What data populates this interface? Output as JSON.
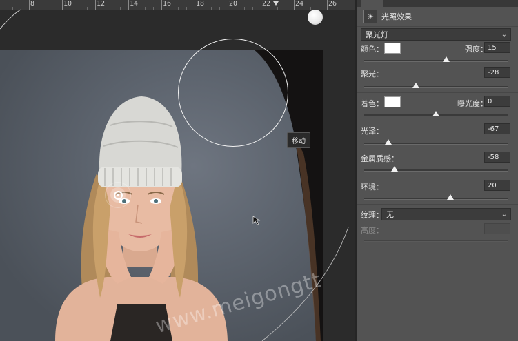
{
  "ruler": {
    "numbers": [
      "8",
      "10",
      "12",
      "14",
      "16",
      "18",
      "20",
      "22",
      "24",
      "26"
    ]
  },
  "canvas": {
    "watermark": "www.meigongtt.com",
    "tooltip": "移动"
  },
  "panel": {
    "title": "光照效果",
    "preset": "聚光灯",
    "color_label": "颜色：",
    "intensity_label": "强度：",
    "intensity_value": "15",
    "intensity_pos": 0.57,
    "focus_label": "聚光：",
    "focus_value": "-28",
    "focus_pos": 0.36,
    "colorize_label": "着色：",
    "exposure_label": "曝光度：",
    "exposure_value": "0",
    "exposure_pos": 0.5,
    "gloss_label": "光泽：",
    "gloss_value": "-67",
    "gloss_pos": 0.17,
    "metallic_label": "金属质感：",
    "metallic_value": "-58",
    "metallic_pos": 0.21,
    "ambience_label": "环境：",
    "ambience_value": "20",
    "ambience_pos": 0.6,
    "texture_label": "纹理：",
    "texture_value": "无",
    "height_label": "高度：",
    "swatch_color": "#ffffff"
  }
}
